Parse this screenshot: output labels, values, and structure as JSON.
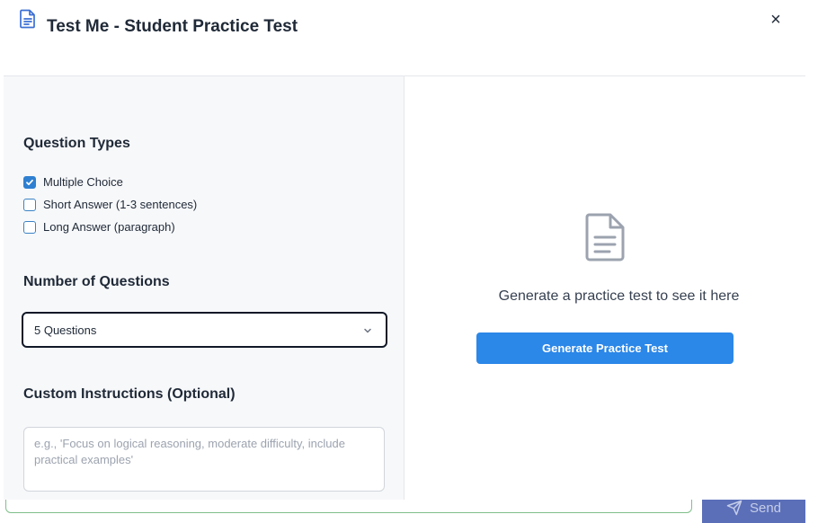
{
  "modal": {
    "title": "Test Me - Student Practice Test",
    "close_label": "×"
  },
  "question_types": {
    "title": "Question Types",
    "options": [
      {
        "label": "Multiple Choice",
        "checked": true
      },
      {
        "label": "Short Answer (1-3 sentences)",
        "checked": false
      },
      {
        "label": "Long Answer (paragraph)",
        "checked": false
      }
    ]
  },
  "number_of_questions": {
    "title": "Number of Questions",
    "selected": "5 Questions"
  },
  "custom_instructions": {
    "title": "Custom Instructions (Optional)",
    "placeholder": "e.g., 'Focus on logical reasoning, moderate difficulty, include practical examples'"
  },
  "preview": {
    "empty_message": "Generate a practice test to see it here",
    "generate_button": "Generate Practice Test"
  },
  "background": {
    "send_label": "Send"
  },
  "colors": {
    "accent": "#2b87e8",
    "checkbox": "#2f80d1"
  }
}
